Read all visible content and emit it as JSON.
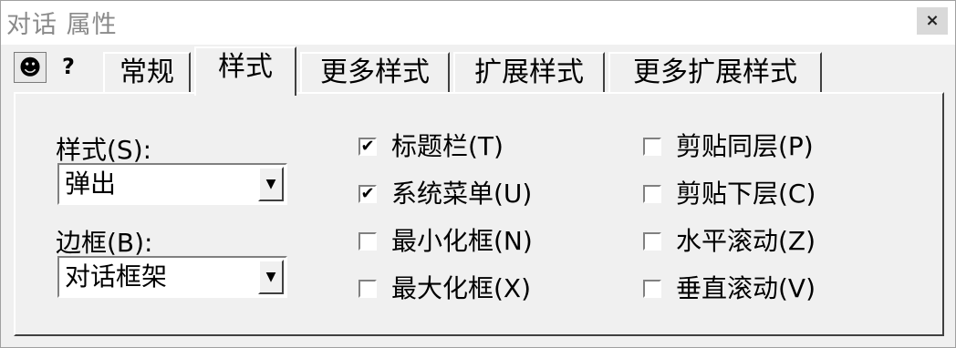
{
  "window": {
    "title": "对话 属性",
    "close_glyph": "×"
  },
  "header_icons": {
    "pin": "pin-icon",
    "help": "help-icon",
    "pin_glyph": "☻",
    "help_glyph": "?"
  },
  "tabs": [
    {
      "label": "常规",
      "active": false
    },
    {
      "label": "样式",
      "active": true
    },
    {
      "label": "更多样式",
      "active": false
    },
    {
      "label": "扩展样式",
      "active": false
    },
    {
      "label": "更多扩展样式",
      "active": false
    }
  ],
  "style": {
    "label": "样式(S):",
    "value": "弹出"
  },
  "border": {
    "label": "边框(B):",
    "value": "对话框架"
  },
  "checkboxes_left": [
    {
      "label": "标题栏(T)",
      "checked": true
    },
    {
      "label": "系统菜单(U)",
      "checked": true
    },
    {
      "label": "最小化框(N)",
      "checked": false
    },
    {
      "label": "最大化框(X)",
      "checked": false
    }
  ],
  "checkboxes_right": [
    {
      "label": "剪贴同层(P)",
      "checked": false
    },
    {
      "label": "剪贴下层(C)",
      "checked": false
    },
    {
      "label": "水平滚动(Z)",
      "checked": false
    },
    {
      "label": "垂直滚动(V)",
      "checked": false
    }
  ],
  "check_glyph": "✔",
  "dropdown_glyph": "▼"
}
